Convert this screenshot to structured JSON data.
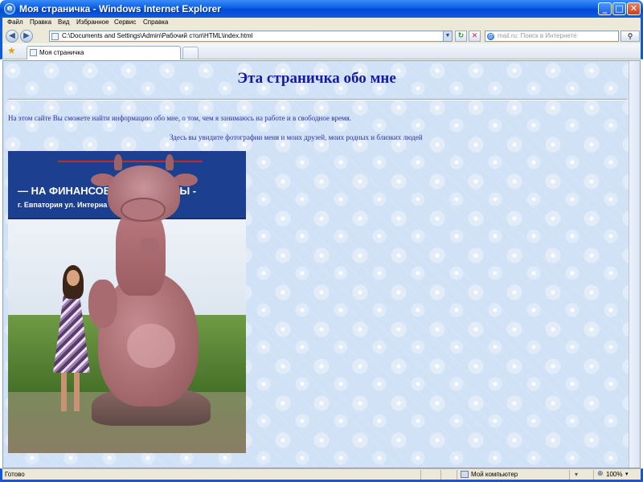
{
  "window": {
    "title": "Моя страничка - Windows Internet Explorer",
    "app_icon": "ie-icon",
    "controls": {
      "minimize": "_",
      "maximize": "□",
      "close": "✕"
    }
  },
  "menu": {
    "items": [
      "Файл",
      "Правка",
      "Вид",
      "Избранное",
      "Сервис",
      "Справка"
    ]
  },
  "address": {
    "url": "C:\\Documents and Settings\\Admin\\Рабочий стол\\HTML\\index.html",
    "back_glyph": "◀",
    "forward_glyph": "▶",
    "dropdown_glyph": "▼",
    "refresh_glyph": "↻",
    "stop_glyph": "✕"
  },
  "search": {
    "logo": "@",
    "placeholder": "mail.ru: Поиск в Интернете",
    "go_glyph": "⚲"
  },
  "tabs": {
    "favorites_glyph": "★",
    "active_label": "Моя страничка"
  },
  "page": {
    "title": "Эта страничка обо мне",
    "intro": "На этом сайте Вы сможете найти информацию обо мне, о том, чем я занимаюсь на работе и в свободное время.",
    "photos_note": "Здесь вы увидите фотографии меня и моих друзей, моих родных и близких людей",
    "billboard": {
      "line1": "— НА ФИНАНСОВО    КЕ УКРАИНЫ -",
      "line2": "г. Евпатория ул. Интерна      3 тел. (06569) 29"
    }
  },
  "status": {
    "text": "Готово",
    "zone": "Мой компьютер",
    "zoom_glyph": "⊕",
    "zoom": "100%",
    "zoom_dd": "▾"
  }
}
